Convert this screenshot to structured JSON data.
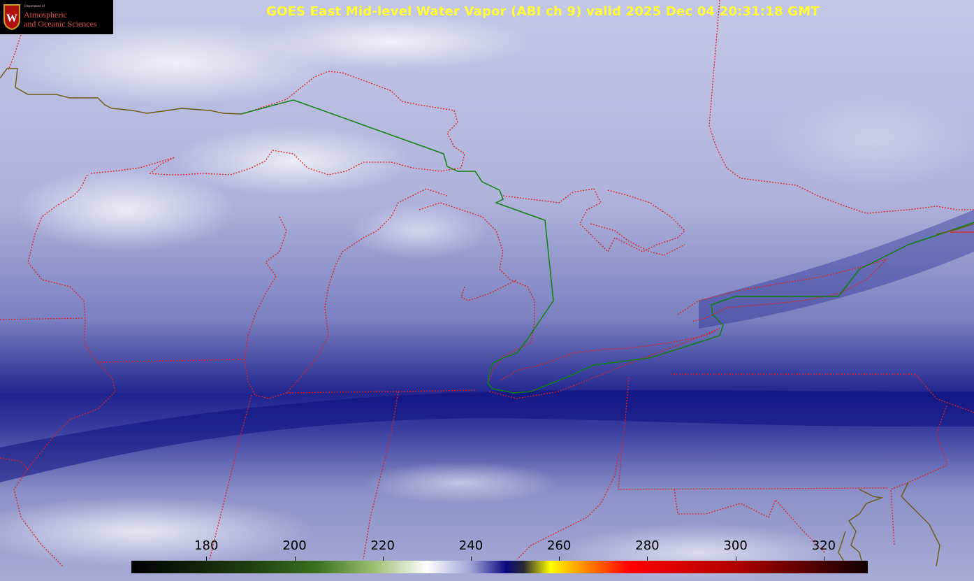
{
  "title": "GOES East Mid-level Water Vapor (ABI ch 9)  valid 2025 Dec 04 20:31:18 GMT",
  "logo": {
    "department": "Department of",
    "line1": "Atmospheric",
    "line2": "and Oceanic Sciences",
    "seal_letter": "W"
  },
  "colorbar": {
    "ticks": [
      {
        "label": "180",
        "value": 180
      },
      {
        "label": "200",
        "value": 200
      },
      {
        "label": "220",
        "value": 220
      },
      {
        "label": "240",
        "value": 240
      },
      {
        "label": "260",
        "value": 260
      },
      {
        "label": "280",
        "value": 280
      },
      {
        "label": "300",
        "value": 300
      },
      {
        "label": "320",
        "value": 320
      }
    ],
    "range": [
      163,
      330
    ],
    "stops": [
      {
        "value": 163,
        "color": "#000000"
      },
      {
        "value": 190,
        "color": "#1f3f10"
      },
      {
        "value": 205,
        "color": "#3a7020"
      },
      {
        "value": 218,
        "color": "#9cc070"
      },
      {
        "value": 230,
        "color": "#ffffff"
      },
      {
        "value": 240,
        "color": "#9ea4d6"
      },
      {
        "value": 248,
        "color": "#0a0a80"
      },
      {
        "value": 252,
        "color": "#2a2a30"
      },
      {
        "value": 258,
        "color": "#ffff00"
      },
      {
        "value": 266,
        "color": "#ff8800"
      },
      {
        "value": 276,
        "color": "#ff0000"
      },
      {
        "value": 300,
        "color": "#b00000"
      },
      {
        "value": 330,
        "color": "#100000"
      }
    ]
  },
  "colors": {
    "state_borders": "#e02020",
    "canada_us_border": "#108010",
    "coastline": "#6b5a10"
  }
}
